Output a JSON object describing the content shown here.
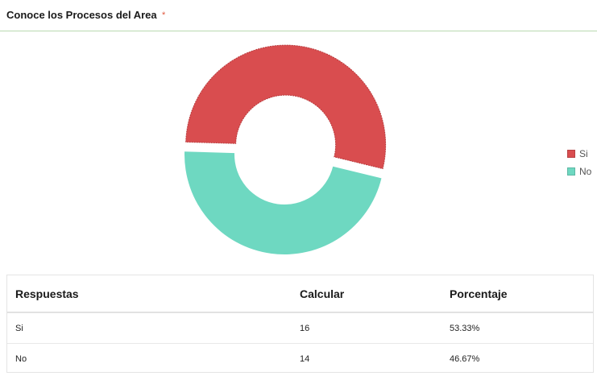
{
  "header": {
    "title": "Conoce los Procesos del Area",
    "required_mark": "*"
  },
  "chart_data": {
    "type": "pie",
    "variant": "donut",
    "categories": [
      "Si",
      "No"
    ],
    "values": [
      16,
      14
    ],
    "colors": [
      "#d94d4f",
      "#6ed8c1"
    ],
    "legend_position": "right",
    "exploded_slice": "Si"
  },
  "legend": {
    "items": [
      {
        "label": "Si",
        "color": "#d94d4f"
      },
      {
        "label": "No",
        "color": "#6ed8c1"
      }
    ]
  },
  "table": {
    "headers": [
      "Respuestas",
      "Calcular",
      "Porcentaje"
    ],
    "rows": [
      [
        "Si",
        "16",
        "53.33%"
      ],
      [
        "No",
        "14",
        "46.67%"
      ]
    ]
  }
}
